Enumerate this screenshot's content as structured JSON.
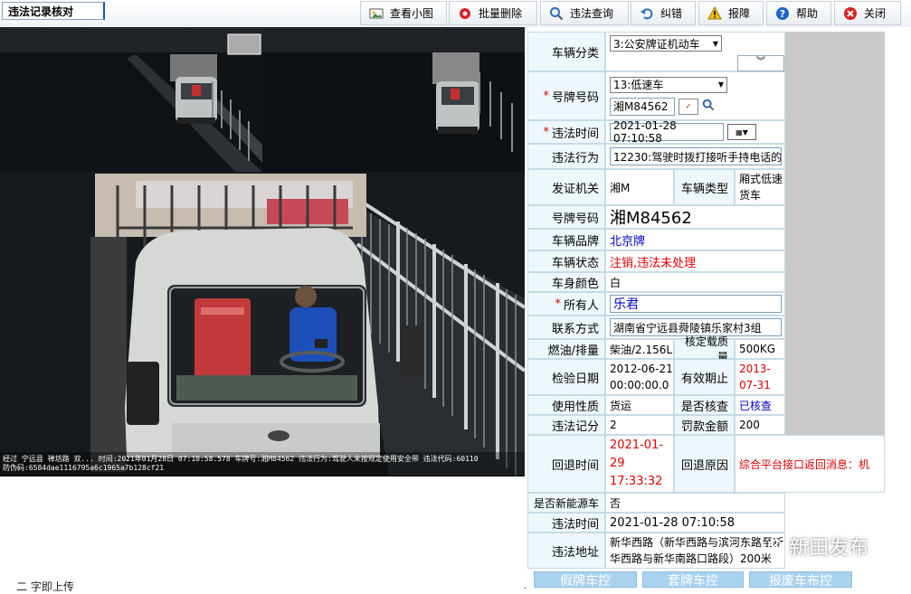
{
  "title": "违法记录核对",
  "toolbar": {
    "view_thumb": "查看小图",
    "batch_delete": "批量删除",
    "violation_query": "违法查询",
    "correct": "纠错",
    "alarm": "报障",
    "help": "帮助",
    "close": "关闭"
  },
  "capture_overlay": {
    "line1": "经过 宁远县 禅坊路 双... 时间:2021年01月28日 07:10:58.578 车牌号:湘M84562 违法行为:驾驶人未按规定使用安全带 违法代码:60110",
    "line2": "防伪码:6584dae1116795a6c1965a7b128cf21"
  },
  "form": {
    "vehicle_class_label": "车辆分类",
    "vehicle_class_value": "3:公安牌证机动车",
    "plate_type_label": "号牌号码",
    "plate_type_value": "13:低速车",
    "plate_input_value": "湘M84562",
    "violation_time_label": "违法时间",
    "violation_time_value": "2021-01-28 07:10:58",
    "violation_act_label": "违法行为",
    "violation_act_value": "12230:驾驶时拨打接听手持电话的",
    "issuer_label": "发证机关",
    "issuer_value": "湘M",
    "vehicle_type_label": "车辆类型",
    "vehicle_type_value": "厢式低速货车",
    "plate_no_label": "号牌号码",
    "plate_no_value": "湘M84562",
    "brand_label": "车辆品牌",
    "brand_value": "北京牌",
    "status_label": "车辆状态",
    "status_value": "注销,违法未处理",
    "color_label": "车身颜色",
    "color_value": "白",
    "owner_label": "所有人",
    "owner_value": "乐君",
    "contact_label": "联系方式",
    "contact_value": "湖南省宁远县舜陵镇乐家村3组",
    "fuel_label": "燃油/排量",
    "fuel_value": "柴油/2.156L",
    "load_label": "核定载质量",
    "load_value": "500KG",
    "inspect_label": "检验日期",
    "inspect_value": "2012-06-21 00:00:00.0",
    "valid_label": "有效期止",
    "valid_value": "2013-07-31",
    "use_label": "使用性质",
    "use_value": "货运",
    "checked_label": "是否核查",
    "checked_value": "已核查",
    "score_label": "违法记分",
    "score_value": "2",
    "fine_label": "罚款金额",
    "fine_value": "200",
    "return_time_label": "回退时间",
    "return_time_value": "2021-01-29 17:33:32",
    "return_reason_label": "回退原因",
    "return_reason_value": "综合平台接口返回消息：机",
    "new_energy_label": "是否新能源车",
    "new_energy_value": "否",
    "violation_time2_label": "违法时间",
    "violation_time2_value": "2021-01-28 07:10:58",
    "address_label": "违法地址",
    "address_value": "新华西路（新华西路与滨河东路至新华西路与新华南路口路段）200米"
  },
  "bottom_buttons": {
    "fake_plate": "假牌车控",
    "cover_plate": "套牌车控",
    "scrap": "报废车布控"
  },
  "lower_label": "二 字即上传",
  "watermark": "新田发布",
  "colors": {
    "accent": "#1a56b0",
    "label_bg": "#eef7fc",
    "alert_red": "#e00000",
    "link_blue": "#0000cc"
  }
}
